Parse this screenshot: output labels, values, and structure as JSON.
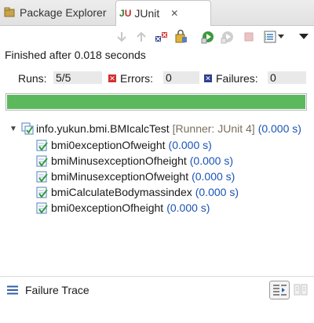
{
  "tabs": {
    "package_explorer": "Package Explorer",
    "junit": "JUnit",
    "junit_icon_j": "J",
    "junit_icon_u": "U",
    "close_glyph": "✕"
  },
  "toolbar": {
    "icons": [
      "next-failure-icon",
      "previous-failure-icon",
      "show-failures-only-icon",
      "scroll-lock-icon",
      "rerun-test-icon",
      "rerun-failed-first-icon",
      "stop-icon",
      "test-run-history-icon",
      "view-menu-icon"
    ]
  },
  "status": {
    "text": "Finished after 0.018 seconds"
  },
  "counters": {
    "runs_label": "Runs:",
    "runs_value": "5/5",
    "errors_label": "Errors:",
    "errors_value": "0",
    "failures_label": "Failures:",
    "failures_value": "0"
  },
  "progress": {
    "fraction": 1.0,
    "color": "#5cb85c"
  },
  "tree": {
    "root": {
      "name": "info.yukun.bmi.BMIcalcTest",
      "runner": "[Runner: JUnit 4]",
      "time": "(0.000 s)"
    },
    "tests": [
      {
        "name": "bmi0exceptionOfweight",
        "time": "(0.000 s)"
      },
      {
        "name": "bmiMinusexceptionOfheight",
        "time": "(0.000 s)"
      },
      {
        "name": "bmiMinusexceptionOfweight",
        "time": "(0.000 s)"
      },
      {
        "name": "bmiCalculateBodymassindex",
        "time": "(0.000 s)"
      },
      {
        "name": "bmi0exceptionOfheight",
        "time": "(0.000 s)"
      }
    ]
  },
  "footer": {
    "label": "Failure Trace"
  },
  "colors": {
    "pass": "#2e9e3e",
    "error": "#d32f2f",
    "failure": "#2b3f8f",
    "time": "#1a53b7"
  }
}
